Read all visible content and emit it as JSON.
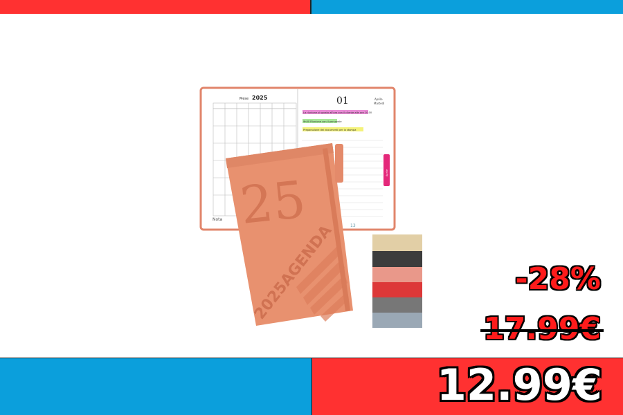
{
  "product": {
    "planner_header": {
      "month": "Mese",
      "year": "2025",
      "day": "01",
      "month_name": "Aprile",
      "weekday": "Martedì"
    },
    "planner_notes": [
      "La riunione si sposta all'ora con il cliente alle ore 10.00",
      "9h00 Riunione con il personale",
      "Preparazione dei documenti per la stampa"
    ],
    "planner_note_label": "Nota",
    "planner_tab": "Aprile",
    "cover_number": "25",
    "cover_text": "2025AGENDA",
    "page_number": "13",
    "colors": {
      "cover": "#e8916f",
      "planner_border": "#e1856b",
      "tab": "#e4287a"
    }
  },
  "badges": {
    "discount": "-28%",
    "old_price": "17.99€",
    "new_price": "12.99€"
  },
  "colors": {
    "red": "#ff3131",
    "blue": "#0b9fdc"
  }
}
